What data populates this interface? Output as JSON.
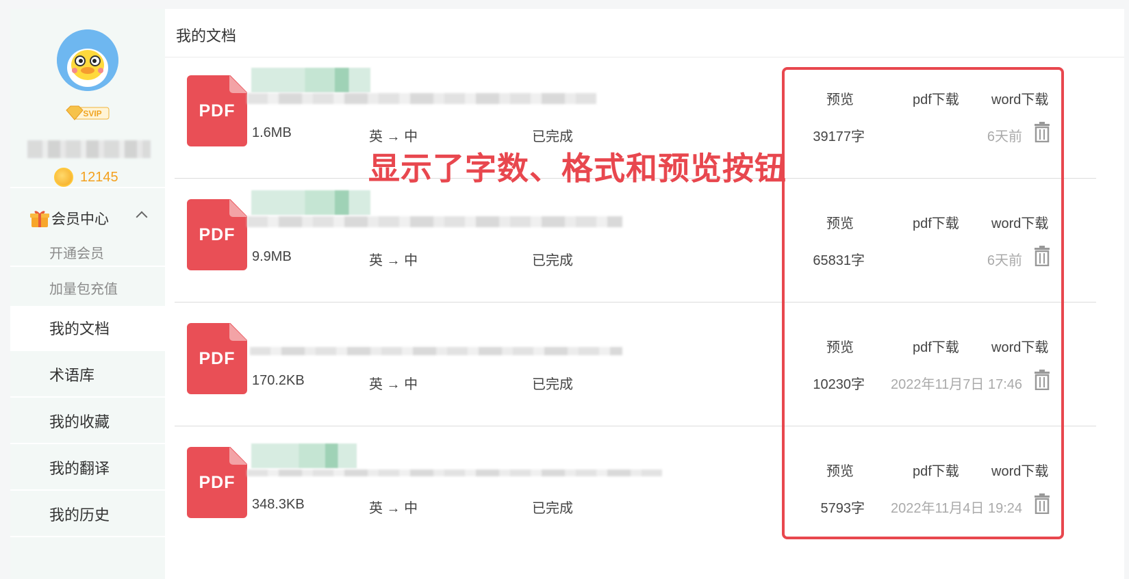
{
  "sidebar": {
    "svip_label": "SVIP",
    "coins": "12145",
    "vip_center": "会员中心",
    "sub_items": [
      "开通会员",
      "加量包充值"
    ],
    "nav": [
      "我的文档",
      "术语库",
      "我的收藏",
      "我的翻译",
      "我的历史"
    ],
    "active_nav": "我的文档"
  },
  "main": {
    "title": "我的文档",
    "actions": {
      "preview": "预览",
      "pdf_download": "pdf下载",
      "word_download": "word下载"
    },
    "pdf_badge": "PDF",
    "docs": [
      {
        "size": "1.6MB",
        "lang": "英 → 中",
        "status": "已完成",
        "count": "39177字",
        "time": "6天前"
      },
      {
        "size": "9.9MB",
        "lang": "英 → 中",
        "status": "已完成",
        "count": "65831字",
        "time": "6天前"
      },
      {
        "size": "170.2KB",
        "lang": "英 → 中",
        "status": "已完成",
        "count": "10230字",
        "time": "2022年11月7日 17:46"
      },
      {
        "size": "348.3KB",
        "lang": "英 → 中",
        "status": "已完成",
        "count": "5793字",
        "time": "2022年11月4日 19:24"
      }
    ]
  },
  "annotation": {
    "text": "显示了字数、格式和预览按钮",
    "color": "#e8474e"
  },
  "colors": {
    "pdf_red": "#e94f56",
    "coin_orange": "#f3a01e",
    "sidebar_bg": "#f3f8f6"
  }
}
